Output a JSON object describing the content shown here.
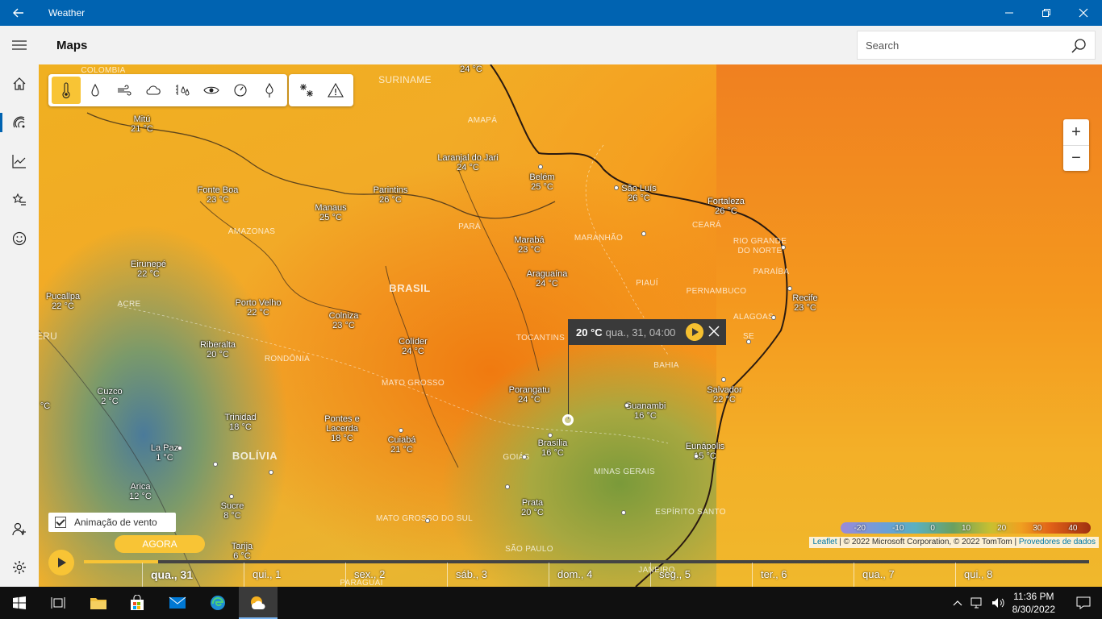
{
  "app": {
    "title": "Weather"
  },
  "header": {
    "page_title": "Maps",
    "search_placeholder": "Search"
  },
  "map": {
    "countries": [
      {
        "name": "BRASIL"
      },
      {
        "name": "BOLÍVIA"
      },
      {
        "name": "COLOMBIA"
      },
      {
        "name": "SURINAME"
      },
      {
        "name": "ERU"
      }
    ],
    "regions": [
      "AMAPÁ",
      "PARÁ",
      "MARANHÃO",
      "CEARÁ",
      "RIO GRANDE",
      "DO NORTE",
      "PARAÍBA",
      "PERNAMBUCO",
      "ALAGOAS",
      "PIAUÍ",
      "AMAZONAS",
      "ACRE",
      "RONDÔNIA",
      "MATO GROSSO",
      "TOCANTINS",
      "BAHIA",
      "GOIÁS",
      "MINAS GERAIS",
      "ESPÍRITO SANTO",
      "MATO GROSSO DO SUL",
      "SÃO PAULO",
      "SE",
      "PARAGUAI",
      "JANEIRO"
    ],
    "cities": [
      {
        "city": "",
        "temp": "24 °C"
      },
      {
        "city": "Mitú",
        "temp": "21 °C"
      },
      {
        "city": "Laranjal do Jari",
        "temp": "24 °C"
      },
      {
        "city": "Belém",
        "temp": "25 °C"
      },
      {
        "city": "São Luís",
        "temp": "26 °C"
      },
      {
        "city": "Fortaleza",
        "temp": "26 °C"
      },
      {
        "city": "Fonte Boa",
        "temp": "23 °C"
      },
      {
        "city": "Manaus",
        "temp": "25 °C"
      },
      {
        "city": "Parintins",
        "temp": "26 °C"
      },
      {
        "city": "Marabá",
        "temp": "23 °C"
      },
      {
        "city": "Araguaína",
        "temp": "24 °C"
      },
      {
        "city": "Recife",
        "temp": "23 °C"
      },
      {
        "city": "Eirunepé",
        "temp": "22 °C"
      },
      {
        "city": "Pucallpa",
        "temp": "22 °C"
      },
      {
        "city": "Porto Velho",
        "temp": "22 °C"
      },
      {
        "city": "Colniza",
        "temp": "23 °C"
      },
      {
        "city": "Colíder",
        "temp": "24 °C"
      },
      {
        "city": "Riberalta",
        "temp": "20 °C"
      },
      {
        "city": "Porangatu",
        "temp": "24 °C"
      },
      {
        "city": "Salvador",
        "temp": "22 °C"
      },
      {
        "city": "Cuzco",
        "temp": "2 °C"
      },
      {
        "city": "Guanambi",
        "temp": "16 °C"
      },
      {
        "city": "Trinidad",
        "temp": "18 °C"
      },
      {
        "city": "Pontes e Lacerda",
        "temp": "18 °C"
      },
      {
        "city": "Cuiabá",
        "temp": "21 °C"
      },
      {
        "city": "Brasília",
        "temp": "16 °C"
      },
      {
        "city": "Eunápolis",
        "temp": "15 °C"
      },
      {
        "city": "La Paz",
        "temp": "1 °C"
      },
      {
        "city": "Arica",
        "temp": "12 °C"
      },
      {
        "city": "Sucre",
        "temp": "8 °C"
      },
      {
        "city": "Prata",
        "temp": "20 °C"
      },
      {
        "city": "Tarija",
        "temp": "6 °C"
      },
      {
        "city": "",
        "temp": "°C"
      }
    ],
    "layers": [
      "temperature-icon",
      "precipitation-icon",
      "wind-icon",
      "cloud-icon",
      "humidity-icon",
      "visibility-icon",
      "pressure-icon",
      "dew-point-icon"
    ],
    "extra_layers": [
      "snow-icon",
      "warning-icon"
    ],
    "zoom": {
      "in": "+",
      "out": "−"
    },
    "popup": {
      "temp": "20 °C",
      "time": "qua., 31, 04:00"
    },
    "wind_animation": {
      "label": "Animação de vento",
      "checked": true
    },
    "legend": [
      "-20",
      "-10",
      "0",
      "10",
      "20",
      "30",
      "40"
    ],
    "attribution": {
      "leaflet": "Leaflet",
      "text": " | © 2022 Microsoft Corporation, © 2022 TomTom | ",
      "providers": "Provedores de dados"
    },
    "timeline": {
      "now_label": "AGORA",
      "days": [
        "qua., 31",
        "qui., 1",
        "sex., 2",
        "sáb., 3",
        "dom., 4",
        "seg., 5",
        "ter., 6",
        "qua., 7",
        "qui., 8"
      ]
    }
  },
  "taskbar": {
    "time": "11:36 PM",
    "date": "8/30/2022"
  }
}
